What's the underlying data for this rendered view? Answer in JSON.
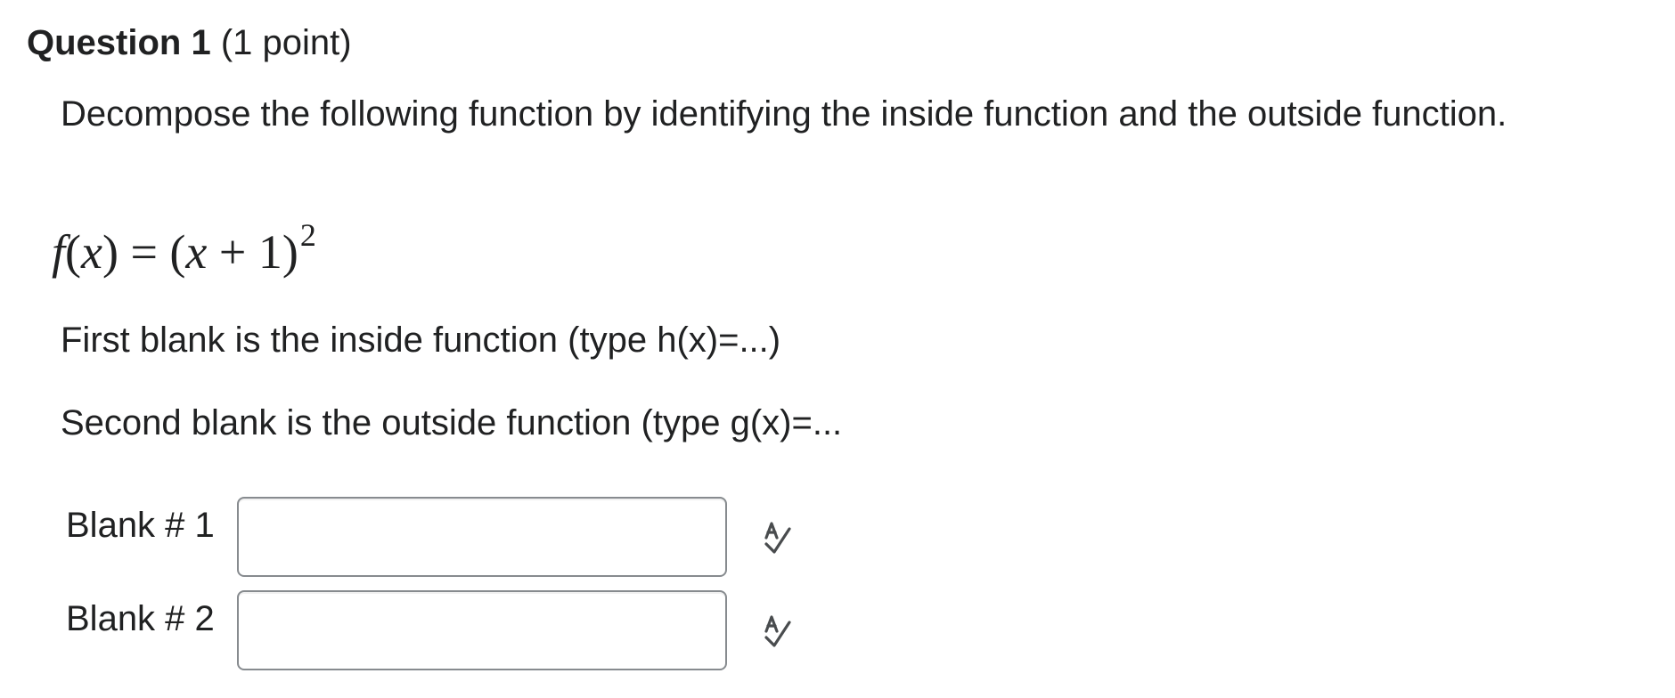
{
  "question": {
    "title": "Question 1",
    "points": "(1 point)"
  },
  "prompt": "Decompose the following function by identifying the inside function and the outside function.",
  "formula": {
    "lhs_f": "f",
    "lhs_paren_open": "(",
    "lhs_var": "x",
    "lhs_paren_close": ")",
    "equals": " = ",
    "rhs_paren_open": "(",
    "rhs_var": "x",
    "rhs_rest": " + 1)",
    "exponent": "2"
  },
  "instructions": [
    "First blank is the inside function (type h(x)=...)",
    "Second blank is the outside function (type g(x)=..."
  ],
  "blanks": [
    {
      "label": "Blank # 1",
      "value": "",
      "spellcheck_icon": "spell-check-icon"
    },
    {
      "label": "Blank # 2",
      "value": "",
      "spellcheck_icon": "spell-check-icon"
    }
  ],
  "colors": {
    "text": "#202122",
    "input_border": "#878b8f",
    "icon": "#494c4e"
  }
}
